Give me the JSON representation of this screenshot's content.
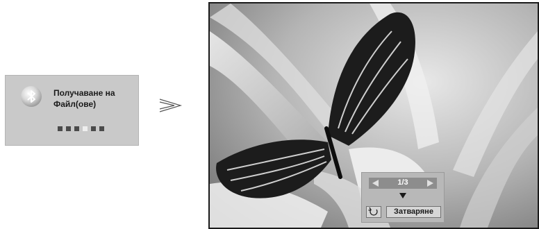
{
  "receive_dialog": {
    "title": "Получаване на\nФайл(ове)",
    "icon": "bluetooth-icon",
    "progress": {
      "total": 6,
      "active_index": 3
    }
  },
  "transition_arrow": {
    "icon": "double-chevron-right-icon"
  },
  "viewer": {
    "page_indicator": "1/3",
    "prev_icon": "triangle-left-icon",
    "next_icon": "triangle-right-icon",
    "down_icon": "triangle-down-icon",
    "rotate_icon": "rotate-icon",
    "close_label": "Затваряне"
  }
}
